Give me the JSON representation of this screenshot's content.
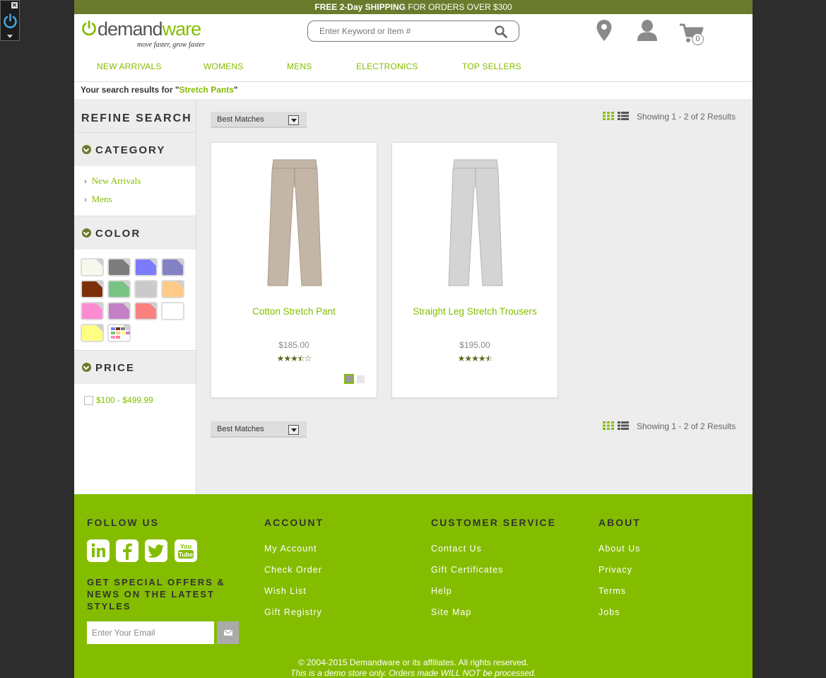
{
  "promo": {
    "bold_text": "FREE 2-Day SHIPPING",
    "rest_text": " FOR ORDERS OVER $300"
  },
  "logo": {
    "brand_a": "demand",
    "brand_b": "ware",
    "tagline": "move faster, grow faster"
  },
  "search": {
    "placeholder": "Enter Keyword or Item #"
  },
  "cart": {
    "count": "0"
  },
  "nav": {
    "items": [
      "NEW ARRIVALS",
      "WOMENS",
      "MENS",
      "ELECTRONICS",
      "TOP SELLERS"
    ]
  },
  "results": {
    "prefix": "Your search results for \"",
    "query": "Stretch Pants",
    "suffix": "\""
  },
  "refine": {
    "title": "REFINE SEARCH",
    "category_title": "CATEGORY",
    "categories": [
      "New Arrivals",
      "Mens"
    ],
    "color_title": "COLOR",
    "colors": [
      "#f8f8ec",
      "#7d7d7d",
      "#7b7bfb",
      "#8282c4",
      "#7d2f0b",
      "#7bc384",
      "#cacaca",
      "#fdcb86",
      "#fb8bd2",
      "#c281c4",
      "#fc8080",
      "#ffffff",
      "#fefe80",
      "multi"
    ],
    "price_title": "PRICE",
    "price_option": "$100 - $499.99"
  },
  "sort": {
    "selected": "Best Matches"
  },
  "showing": "Showing 1 - 2 of 2 Results",
  "products": [
    {
      "name": "Cotton Stretch Pant",
      "price": "$185.00",
      "rating": 3.5,
      "color": "#c4b6a6"
    },
    {
      "name": "Straight Leg Stretch Trousers",
      "price": "$195.00",
      "rating": 4.5,
      "color": "#d4d4d4"
    }
  ],
  "footer": {
    "follow": "FOLLOW US",
    "offer": "GET SPECIAL OFFERS & NEWS ON THE LATEST STYLES",
    "email_placeholder": "Enter Your Email",
    "account_title": "ACCOUNT",
    "account_links": [
      "My Account",
      "Check Order",
      "Wish List",
      "Gift Registry"
    ],
    "service_title": "CUSTOMER SERVICE",
    "service_links": [
      "Contact Us",
      "Gift Certificates",
      "Help",
      "Site Map"
    ],
    "about_title": "ABOUT",
    "about_links": [
      "About Us",
      "Privacy",
      "Terms",
      "Jobs"
    ],
    "copyright": "© 2004-2015 Demandware or its affiliates. All rights reserved.",
    "disclaimer": "This is a demo store only. Orders made WILL NOT be processed."
  },
  "colors": {
    "accent": "#84bd00",
    "olive": "#6a7b2d"
  }
}
